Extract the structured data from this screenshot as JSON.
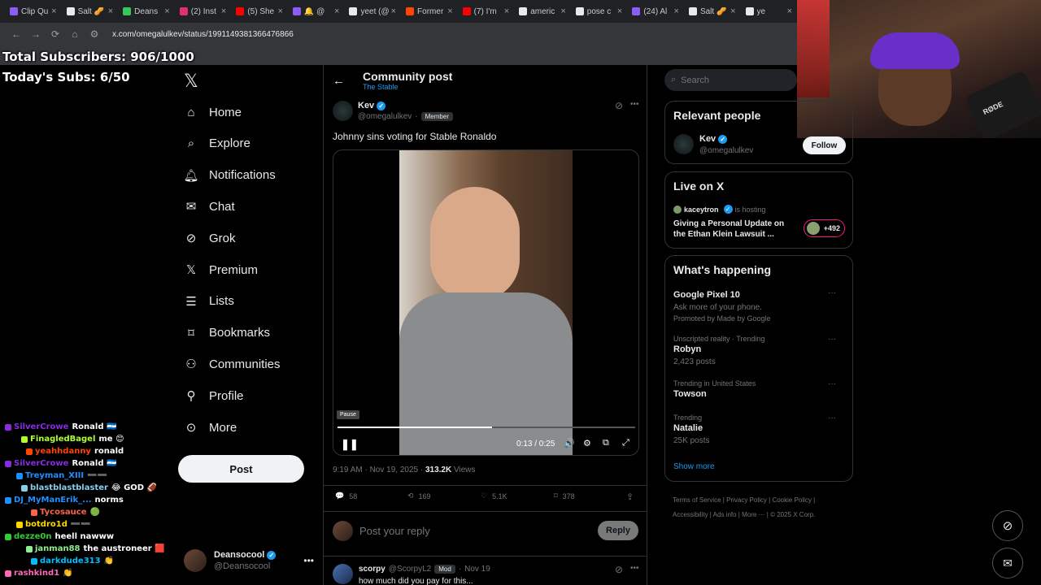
{
  "browser": {
    "tabs": [
      {
        "label": "Clip Qu",
        "color": "#8b5cf6"
      },
      {
        "label": "Salt 🥜",
        "color": "#e7e9ea"
      },
      {
        "label": "Deans",
        "color": "#34c759"
      },
      {
        "label": "(2) Inst",
        "color": "#e1306c"
      },
      {
        "label": "(5) She",
        "color": "#ff0000"
      },
      {
        "label": "🔔 @",
        "color": "#8b5cf6"
      },
      {
        "label": "yeet (@",
        "color": "#e7e9ea"
      },
      {
        "label": "Former",
        "color": "#ff4500"
      },
      {
        "label": "(7) I'm",
        "color": "#ff0000"
      },
      {
        "label": "americ",
        "color": "#e7e9ea"
      },
      {
        "label": "pose c",
        "color": "#e7e9ea"
      },
      {
        "label": "(24) Al",
        "color": "#8b5cf6"
      },
      {
        "label": "Salt 🥜",
        "color": "#e7e9ea"
      },
      {
        "label": "ye",
        "color": "#e7e9ea"
      }
    ],
    "url": "x.com/omegalulkev/status/1991149381366476866"
  },
  "overlay": {
    "total_subs": "Total Subscribers: 906/1000",
    "today_subs": "Today's Subs: 6/50"
  },
  "chat": [
    {
      "user": "SilverCrowe",
      "msg": "Ronald 🇳🇮",
      "color": "#8a2be2"
    },
    {
      "user": "FinagledBagel",
      "msg": "me 😊",
      "color": "#adff2f"
    },
    {
      "user": "yeahhdanny",
      "msg": "ronald",
      "color": "#ff4500"
    },
    {
      "user": "SilverCrowe",
      "msg": "Ronald 🇳🇮",
      "color": "#8a2be2"
    },
    {
      "user": "Treyman_XIII",
      "msg": "➖➖",
      "color": "#1e90ff"
    },
    {
      "user": "blastblastblaster",
      "msg": "😂 GOD 🏈",
      "color": "#87ceeb"
    },
    {
      "user": "DJ_MyManErik_...",
      "msg": "norms",
      "color": "#1e90ff"
    },
    {
      "user": "Tycosauce",
      "msg": "🟢",
      "color": "#ff6347"
    },
    {
      "user": "botdro1d",
      "msg": "➖➖",
      "color": "#ffd700"
    },
    {
      "user": "dezze0n",
      "msg": "heell nawww",
      "color": "#32cd32"
    },
    {
      "user": "janman88",
      "msg": "the austroneer 🟥",
      "color": "#90ee90"
    },
    {
      "user": "darkdude313",
      "msg": "👏",
      "color": "#00bfff"
    },
    {
      "user": "rashkind1",
      "msg": "👏",
      "color": "#ff69b4"
    }
  ],
  "webcam": {
    "mic_label": "RØDE"
  },
  "nav": {
    "items": [
      {
        "label": "Home",
        "icon": "home-icon"
      },
      {
        "label": "Explore",
        "icon": "search-icon"
      },
      {
        "label": "Notifications",
        "icon": "bell-icon"
      },
      {
        "label": "Chat",
        "icon": "envelope-icon"
      },
      {
        "label": "Grok",
        "icon": "grok-icon"
      },
      {
        "label": "Premium",
        "icon": "x-icon"
      },
      {
        "label": "Lists",
        "icon": "list-icon"
      },
      {
        "label": "Bookmarks",
        "icon": "bookmark-icon"
      },
      {
        "label": "Communities",
        "icon": "people-icon"
      },
      {
        "label": "Profile",
        "icon": "person-icon"
      },
      {
        "label": "More",
        "icon": "more-circle-icon"
      }
    ],
    "post_label": "Post",
    "account": {
      "name": "Deansocool",
      "handle": "@Deansocool"
    }
  },
  "main": {
    "header_title": "Community post",
    "header_sub": "The Stable",
    "post": {
      "author": "Kev",
      "handle": "@omegalulkev",
      "role_badge": "Member",
      "text": "Johnny sins voting for Stable Ronaldo",
      "video": {
        "tooltip": "Pause",
        "time": "0:13 / 0:25",
        "progress": 0.52
      },
      "timestamp": "9:19 AM · Nov 19, 2025 · ",
      "views_count": "313.2K",
      "views_label": " Views",
      "stats": {
        "replies": "58",
        "reposts": "169",
        "likes": "5.1K",
        "bookmarks": "378"
      }
    },
    "reply_box": {
      "placeholder": "Post your reply",
      "button": "Reply"
    },
    "reply": {
      "author": "scorpy",
      "handle": "@ScorpyL2",
      "badge": "Mod",
      "date": "Nov 19",
      "text": "how much did you pay for this..."
    }
  },
  "sidebar": {
    "search_placeholder": "Search",
    "relevant": {
      "title": "Relevant people",
      "name": "Kev",
      "handle": "@omegalulkev",
      "follow": "Follow"
    },
    "live": {
      "title": "Live on X",
      "host": "kaceytron",
      "hosting": "is hosting",
      "space_title": "Giving a Personal Update on the Ethan Klein Lawsuit ...",
      "listeners": "+492"
    },
    "happening": {
      "title": "What's happening",
      "trends": [
        {
          "meta": "",
          "name": "Google Pixel 10",
          "sub": "Ask more of your phone.",
          "promo": "Promoted by Made by Google"
        },
        {
          "meta": "Unscripted reality · Trending",
          "name": "Robyn",
          "sub": "2,423 posts",
          "promo": ""
        },
        {
          "meta": "Trending in United States",
          "name": "Towson",
          "sub": "",
          "promo": ""
        },
        {
          "meta": "Trending",
          "name": "Natalie",
          "sub": "25K posts",
          "promo": ""
        }
      ],
      "show_more": "Show more"
    },
    "footer": {
      "links": [
        "Terms of Service",
        "Privacy Policy",
        "Cookie Policy",
        "Accessibility",
        "Ads info",
        "More ···",
        "© 2025 X Corp."
      ]
    }
  },
  "colors": {
    "accent": "#1d9bf0",
    "background": "#000000",
    "border": "#2f3336",
    "muted": "#71767b"
  }
}
